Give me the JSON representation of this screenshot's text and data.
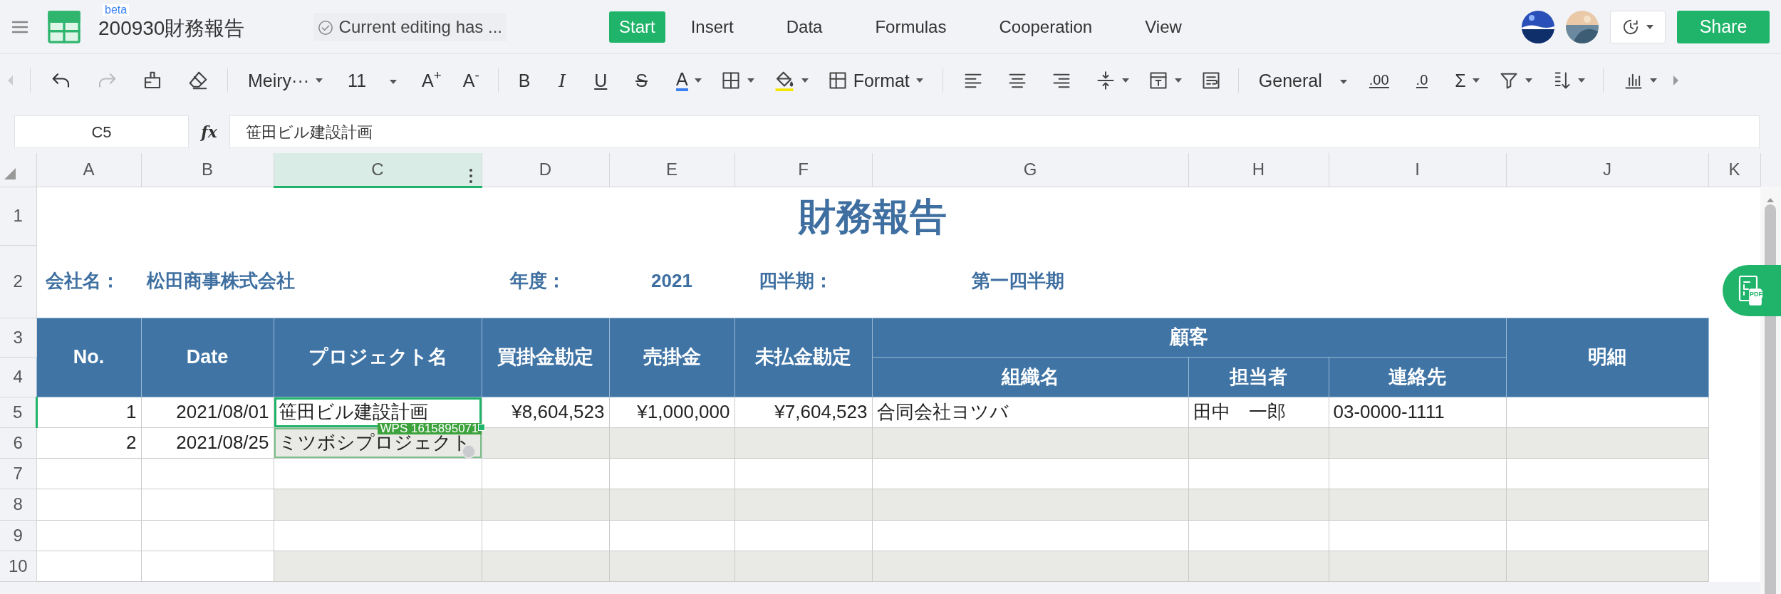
{
  "topbar": {
    "title": "200930財務報告",
    "badge": "beta",
    "status": "Current editing has ...",
    "tabs": [
      {
        "label": "Start",
        "selected": true
      },
      {
        "label": "Insert",
        "selected": false
      },
      {
        "label": "Data",
        "selected": false
      },
      {
        "label": "Formulas",
        "selected": false
      },
      {
        "label": "Cooperation",
        "selected": false
      },
      {
        "label": "View",
        "selected": false
      }
    ],
    "share": "Share"
  },
  "toolbar": {
    "undo": {
      "disabled": false
    },
    "redo": {
      "disabled": true
    },
    "font": "Meiry···",
    "font_size": "11",
    "grow_font": "A$^{+}$",
    "shrink_font": "A$^{-}$",
    "bold": "B",
    "italic": "I",
    "underline": "U",
    "strikethrough": "S",
    "font_color": "A",
    "format": "Format",
    "number_format": "General",
    "add_decimal": ".00",
    "remove_decimal": ".0",
    "sum": "Σ"
  },
  "formula_bar": {
    "cell": "C5",
    "fx": "fx",
    "value": "笹田ビル建設計画"
  },
  "columns": [
    {
      "label": "A",
      "selected": false
    },
    {
      "label": "B",
      "selected": false
    },
    {
      "label": "C",
      "selected": true
    },
    {
      "label": "D",
      "selected": false
    },
    {
      "label": "E",
      "selected": false
    },
    {
      "label": "F",
      "selected": false
    },
    {
      "label": "G",
      "selected": false
    },
    {
      "label": "H",
      "selected": false
    },
    {
      "label": "I",
      "selected": false
    },
    {
      "label": "J",
      "selected": false
    },
    {
      "label": "K",
      "selected": false
    }
  ],
  "row_headers": [
    {
      "label": "1",
      "selected": false
    },
    {
      "label": "2",
      "selected": false
    },
    {
      "label": "3",
      "selected": false
    },
    {
      "label": "4",
      "selected": false
    },
    {
      "label": "5",
      "selected": true
    },
    {
      "label": "6",
      "selected": false
    },
    {
      "label": "7",
      "selected": false
    },
    {
      "label": "8",
      "selected": false
    },
    {
      "label": "9",
      "selected": false
    },
    {
      "label": "10",
      "selected": false
    }
  ],
  "sheet": {
    "title": "財務報告",
    "company_label": "会社名：",
    "company": "松田商事株式会社",
    "year_label": "年度：",
    "year": "2021",
    "quarter_label": "四半期：",
    "quarter": "第一四半期"
  },
  "table_header": {
    "no": "No.",
    "date": "Date",
    "project": "プロジェクト名",
    "payable": "買掛金勘定",
    "receivable": "売掛金",
    "accrued": "未払金勘定",
    "customer": "顧客",
    "organization": "組織名",
    "person": "担当者",
    "phone": "連絡先",
    "details": "明細"
  },
  "rows": [
    {
      "shaded": false,
      "no": "1",
      "date": "2021/08/01",
      "project": "笹田ビル建設計画",
      "payable": "¥8,604,523",
      "receivable": "¥1,000,000",
      "accrued": "¥7,604,523",
      "organization": "合同会社ヨツバ",
      "person": "田中　一郎",
      "phone": "03-0000-1111"
    },
    {
      "shaded": true,
      "no": "2",
      "date": "2021/08/25",
      "project": "ミツボシプロジェクト",
      "collaborator": {
        "label": "WPS 1615895071"
      }
    },
    {
      "shaded": false
    },
    {
      "shaded": true
    },
    {
      "shaded": false
    },
    {
      "shaded": true
    }
  ],
  "pdf_button": {
    "label": "PDF"
  }
}
